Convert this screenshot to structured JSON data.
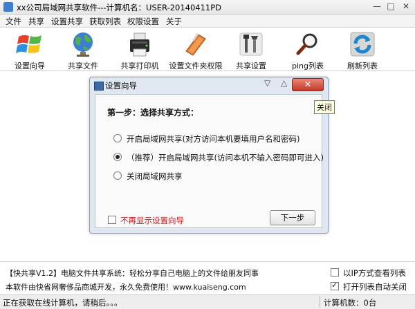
{
  "window": {
    "title": "xx公司局域网共享软件---计算机名：USER-20140411PD",
    "minimize": "—",
    "maximize": "□",
    "close": "✕"
  },
  "menu": [
    "文件",
    "共享",
    "设置共享",
    "获取列表",
    "权限设置",
    "关于"
  ],
  "toolbar": [
    {
      "label": "设置向导",
      "icon": "windows-logo-icon"
    },
    {
      "label": "共享文件",
      "icon": "globe-icon"
    },
    {
      "label": "共享打印机",
      "icon": "printer-icon"
    },
    {
      "label": "设置文件夹权限",
      "icon": "folder-lock-icon"
    },
    {
      "label": "共享设置",
      "icon": "tools-icon"
    },
    {
      "label": "ping列表",
      "icon": "magnifier-icon"
    },
    {
      "label": "刷新列表",
      "icon": "refresh-icon"
    }
  ],
  "dialog": {
    "title": "设置向导",
    "min": "▽",
    "max": "△",
    "close": "✕",
    "heading": "第一步：选择共享方式：",
    "options": [
      "开启局域网共享(对方访问本机要填用户名和密码)",
      "（推荐）开启局域网共享(访问本机不输入密码即可进入)",
      "关闭局域网共享"
    ],
    "selected_option": 1,
    "dont_show_label": "不再显示设置向导",
    "dont_show_checked": false,
    "next_button": "下一步"
  },
  "tooltip": "关闭",
  "info": {
    "line1": "【快共享V1.2】电脑文件共享系统：轻松分享自己电脑上的文件给朋友同事",
    "line2": "本软件由快省网奢侈品商城开发，永久免费使用！www.kuaiseng.com"
  },
  "options": [
    {
      "label": "以IP方式查看列表",
      "checked": false
    },
    {
      "label": "打开列表自动关闭",
      "checked": true
    }
  ],
  "status": {
    "left": "正在获取在线计算机，请稍后。。。",
    "right": "计算机数：0台"
  }
}
